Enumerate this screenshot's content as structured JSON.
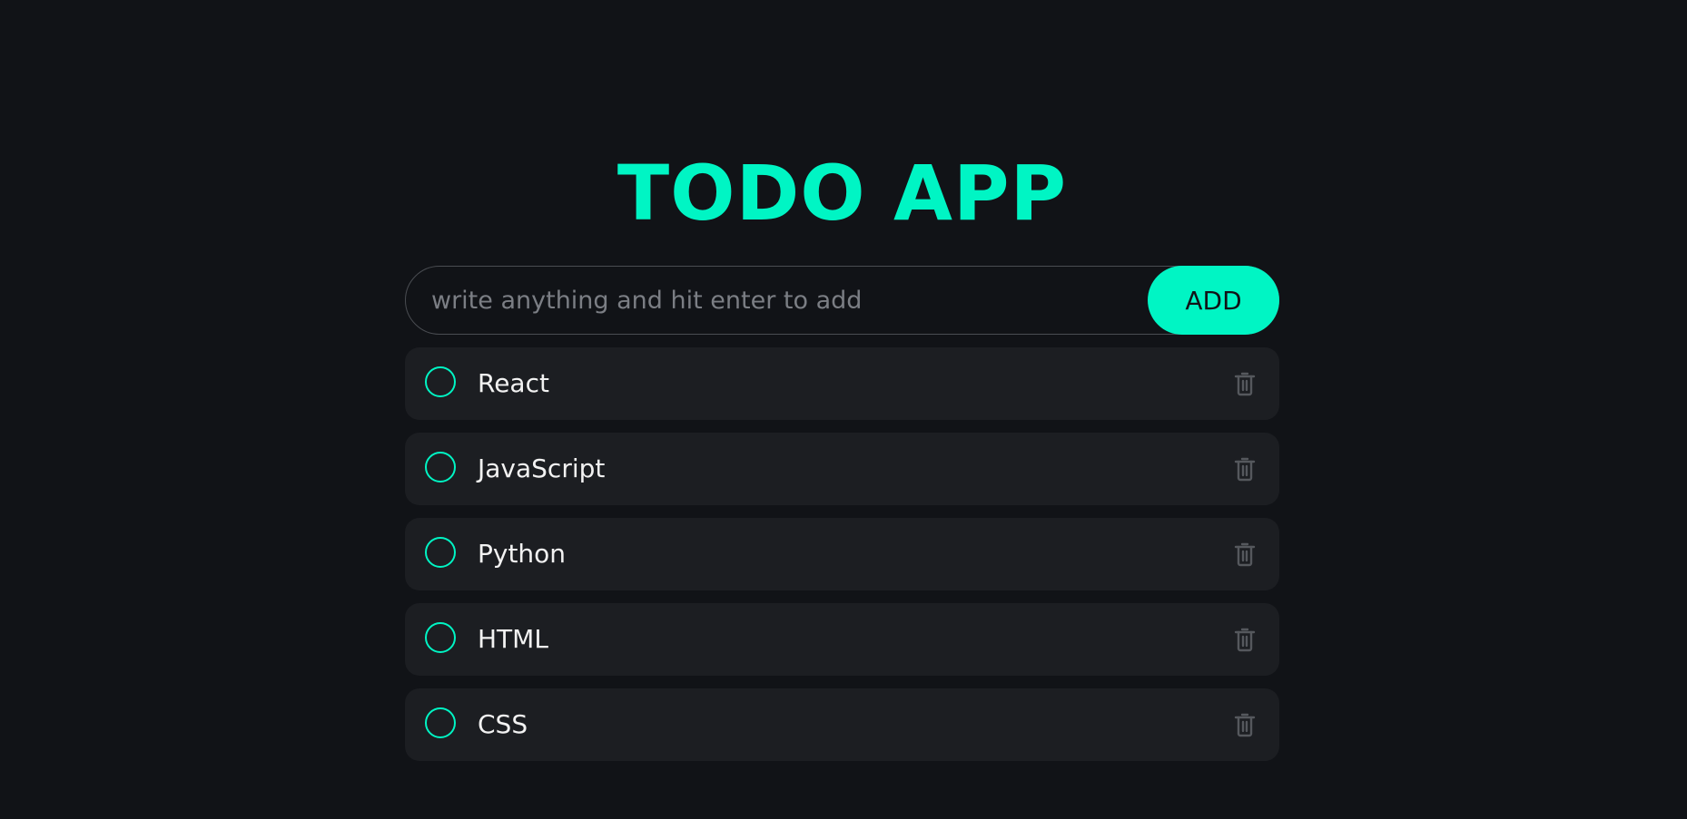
{
  "app": {
    "title": "TODO APP",
    "accent_color": "#00F5C4",
    "background_color": "#111317"
  },
  "input": {
    "placeholder": "write anything and hit enter to add",
    "value": "",
    "add_label": "ADD"
  },
  "todos": [
    {
      "text": "React",
      "completed": false,
      "check_icon": "circle-outline-icon",
      "delete_icon": "trash-icon"
    },
    {
      "text": "JavaScript",
      "completed": false,
      "check_icon": "circle-outline-icon",
      "delete_icon": "trash-icon"
    },
    {
      "text": "Python",
      "completed": false,
      "check_icon": "circle-outline-icon",
      "delete_icon": "trash-icon"
    },
    {
      "text": "HTML",
      "completed": false,
      "check_icon": "circle-outline-icon",
      "delete_icon": "trash-icon"
    },
    {
      "text": "CSS",
      "completed": false,
      "check_icon": "circle-outline-icon",
      "delete_icon": "trash-icon"
    }
  ]
}
